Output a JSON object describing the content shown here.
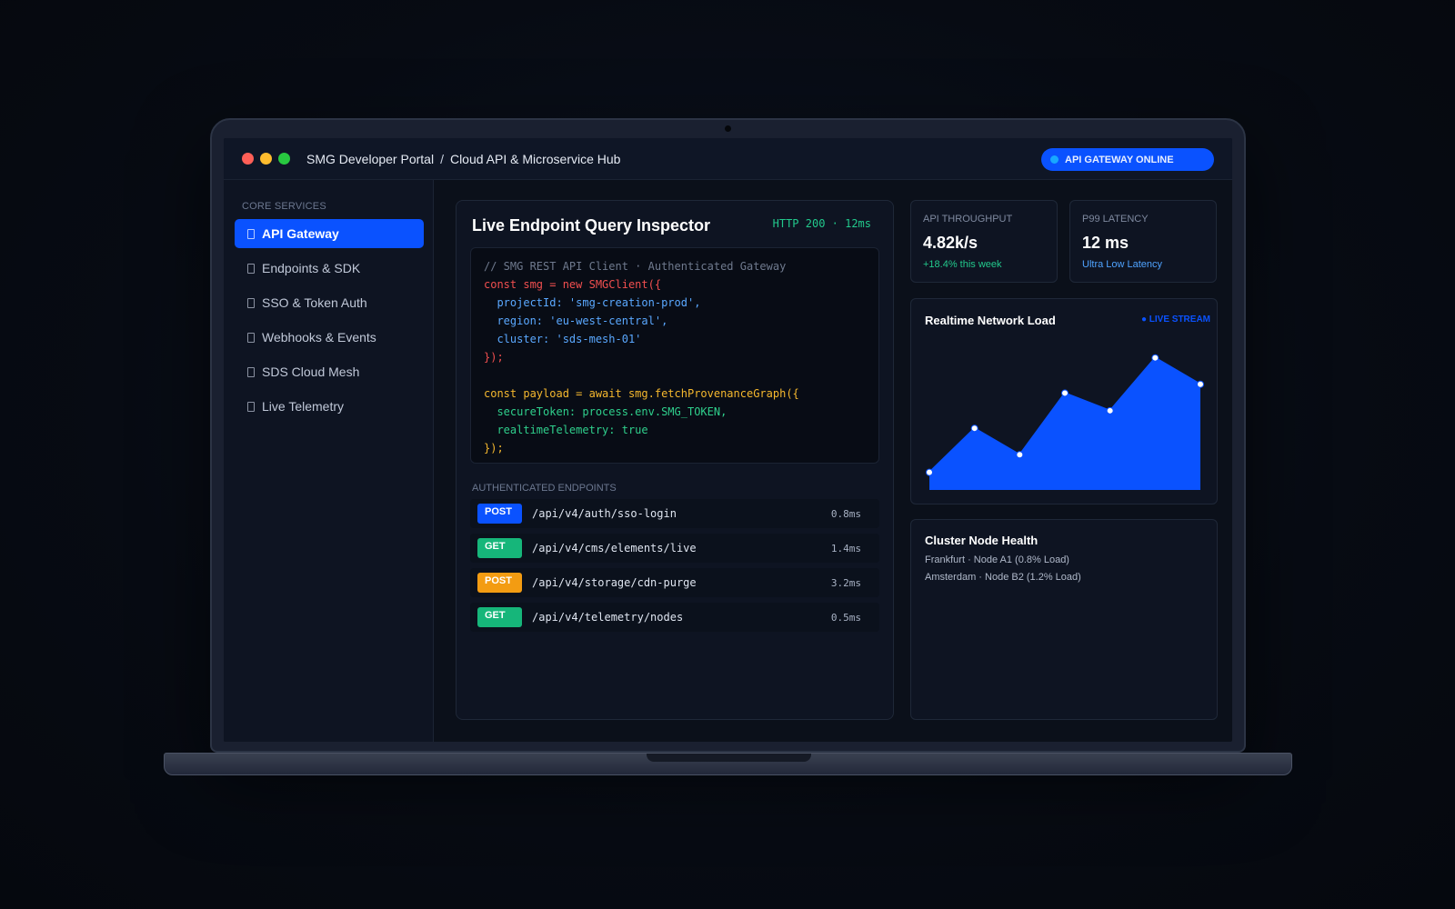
{
  "window": {
    "breadcrumb": [
      "SMG Developer Portal",
      "/",
      "Cloud API & Microservice Hub"
    ],
    "status_pill": "API GATEWAY ONLINE"
  },
  "sidebar": {
    "heading": "CORE SERVICES",
    "items": [
      {
        "label": "API Gateway",
        "icon": "document-icon",
        "active": true
      },
      {
        "label": "Endpoints & SDK",
        "icon": "document-icon",
        "active": false
      },
      {
        "label": "SSO & Token Auth",
        "icon": "document-icon",
        "active": false
      },
      {
        "label": "Webhooks & Events",
        "icon": "document-icon",
        "active": false
      },
      {
        "label": "SDS Cloud Mesh",
        "icon": "document-icon",
        "active": false
      },
      {
        "label": "Live Telemetry",
        "icon": "document-icon",
        "active": false
      }
    ]
  },
  "inspector": {
    "title": "Live Endpoint Query Inspector",
    "status": "HTTP 200 · 12ms",
    "code": [
      {
        "text": "// SMG REST API Client · Authenticated Gateway",
        "tone": "comment"
      },
      {
        "text": "const smg = new SMGClient({",
        "tone": "red"
      },
      {
        "text": "  projectId: 'smg-creation-prod',",
        "tone": "blue"
      },
      {
        "text": "  region: 'eu-west-central',",
        "tone": "blue"
      },
      {
        "text": "  cluster: 'sds-mesh-01'",
        "tone": "blue"
      },
      {
        "text": "});",
        "tone": "red"
      },
      {
        "text": "",
        "tone": "comment"
      },
      {
        "text": "const payload = await smg.fetchProvenanceGraph({",
        "tone": "yellow"
      },
      {
        "text": "  secureToken: process.env.SMG_TOKEN,",
        "tone": "green"
      },
      {
        "text": "  realtimeTelemetry: true",
        "tone": "green"
      },
      {
        "text": "});",
        "tone": "yellow"
      }
    ],
    "endpoints_heading": "AUTHENTICATED ENDPOINTS",
    "endpoints": [
      {
        "method": "POST",
        "tone": "post-blue",
        "path": "/api/v4/auth/sso-login",
        "time": "0.8ms"
      },
      {
        "method": "GET",
        "tone": "get-green",
        "path": "/api/v4/cms/elements/live",
        "time": "1.4ms"
      },
      {
        "method": "POST",
        "tone": "post-orange",
        "path": "/api/v4/storage/cdn-purge",
        "time": "3.2ms"
      },
      {
        "method": "GET",
        "tone": "get-green",
        "path": "/api/v4/telemetry/nodes",
        "time": "0.5ms"
      }
    ]
  },
  "metrics": {
    "throughput": {
      "label": "API THROUGHPUT",
      "value": "4.82k/s",
      "sub": "+18.4% this week"
    },
    "latency": {
      "label": "P99 LATENCY",
      "value": "12 ms",
      "sub": "Ultra Low Latency"
    }
  },
  "network_chart": {
    "title": "Realtime Network Load",
    "live_label": "● LIVE STREAM"
  },
  "chart_data": {
    "type": "area",
    "x": [
      0,
      1,
      2,
      3,
      4,
      5,
      6
    ],
    "values": [
      20,
      70,
      40,
      110,
      90,
      150,
      120
    ],
    "ylim": [
      0,
      160
    ],
    "grid": false,
    "color": "#0a52ff"
  },
  "cluster_health": {
    "title": "Cluster Node Health",
    "nodes": [
      "Frankfurt · Node A1 (0.8% Load)",
      "Amsterdam · Node B2 (1.2% Load)"
    ]
  },
  "colors": {
    "accent": "#0a52ff",
    "success": "#22c98c",
    "warning": "#f39c12",
    "background": "#0b101a"
  }
}
